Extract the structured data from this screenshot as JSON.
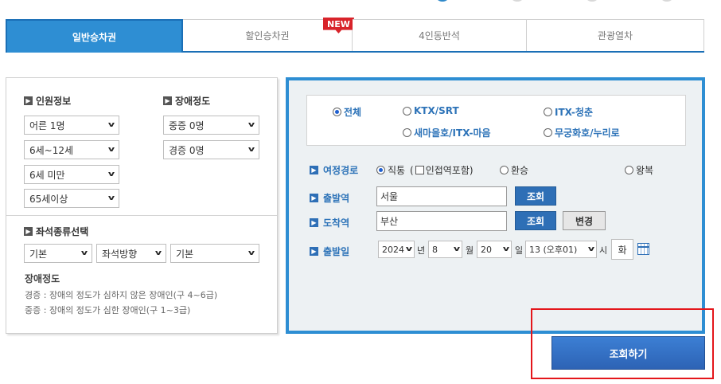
{
  "tabs": [
    {
      "label": "일반승차권",
      "active": true
    },
    {
      "label": "할인승차권",
      "badge": "NEW"
    },
    {
      "label": "4인동반석"
    },
    {
      "label": "관광열차"
    }
  ],
  "passenger": {
    "title": "인원정보",
    "selects": [
      "어른 1명",
      "6세~12세",
      "6세 미만",
      "65세이상"
    ]
  },
  "disability": {
    "title": "장애정도",
    "selects": [
      "중증 0명",
      "경증 0명"
    ]
  },
  "seat": {
    "title": "좌석종류선택",
    "selects": [
      "기본",
      "좌석방향",
      "기본"
    ]
  },
  "disability_info": {
    "title": "장애정도",
    "lines": [
      "경증 : 장애의 정도가 심하지 않은 장애인(구 4~6급)",
      "중증 : 장애의 정도가 심한 장애인(구 1~3급)"
    ]
  },
  "train_types": {
    "all": "전체",
    "ktx": "KTX/SRT",
    "itx_chungchun": "ITX-청춘",
    "saemaeul": "새마을호/ITX-마음",
    "mugunghwa": "무궁화호/누리로"
  },
  "route": {
    "label": "여정경로",
    "direct": "직통",
    "transfer_paren_open": "(",
    "transfer_label": "인접역포함)",
    "transfer": "환승",
    "roundtrip": "왕복"
  },
  "departure": {
    "label": "출발역",
    "value": "서울",
    "button": "조회"
  },
  "arrival": {
    "label": "도착역",
    "value": "부산",
    "button": "조회",
    "change_button": "변경"
  },
  "date": {
    "label": "출발일",
    "year": "2024",
    "year_unit": "년",
    "month": "8",
    "month_unit": "월",
    "day": "20",
    "day_unit": "일",
    "hour": "13 (오후01)",
    "hour_unit": "시",
    "weekday": "화"
  },
  "search_button": "조회하기",
  "colors": {
    "accent": "#2e8ed3",
    "highlight": "#e4161b"
  }
}
